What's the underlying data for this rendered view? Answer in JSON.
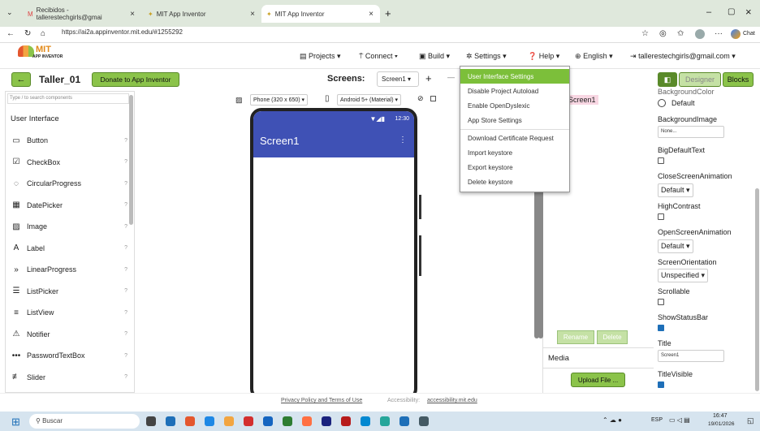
{
  "browser": {
    "tabs": [
      {
        "title": "Recibidos - tallerestechgirls@gmai"
      },
      {
        "title": "MIT App Inventor"
      },
      {
        "title": "MIT App Inventor"
      }
    ],
    "url": "https://ai2a.appinventor.mit.edu/#1255292",
    "chat_label": "Chat"
  },
  "header": {
    "logo_title": "MIT",
    "logo_sub": "APP INVENTOR",
    "menus": [
      "Projects ▾",
      "Connect ▾",
      "Build ▾",
      "Settings ▾",
      "Help ▾",
      "English ▾"
    ],
    "account": "tallerestechgirls@gmail.com ▾"
  },
  "toolbar": {
    "back_label": "←",
    "project_name": "Taller_01",
    "donate_label": "Donate to App Inventor",
    "screens_label": "Screens:",
    "screen_select": "Screen1 ▾",
    "add_label": "+",
    "minus_label": "—",
    "designer_label": "Designer",
    "blocks_label": "Blocks"
  },
  "palette": {
    "search_placeholder": "Type / to search components",
    "category": "User Interface",
    "items": [
      {
        "label": "Button",
        "icon": "▭"
      },
      {
        "label": "CheckBox",
        "icon": "☑"
      },
      {
        "label": "CircularProgress",
        "icon": "◌"
      },
      {
        "label": "DatePicker",
        "icon": "▦"
      },
      {
        "label": "Image",
        "icon": "▨"
      },
      {
        "label": "Label",
        "icon": "A"
      },
      {
        "label": "LinearProgress",
        "icon": "»"
      },
      {
        "label": "ListPicker",
        "icon": "☰"
      },
      {
        "label": "ListView",
        "icon": "≡"
      },
      {
        "label": "Notifier",
        "icon": "⚠"
      },
      {
        "label": "PasswordTextBox",
        "icon": "•••"
      },
      {
        "label": "Slider",
        "icon": "≢"
      }
    ],
    "help": "?"
  },
  "viewer": {
    "device": "Phone (320 x 650) ▾",
    "android": "Android 5+ (Material) ▾",
    "status_time": "12:30",
    "screen_title": "Screen1"
  },
  "components": {
    "screen_item": "Screen1",
    "rename_label": "Rename",
    "delete_label": "Delete",
    "media_label": "Media",
    "upload_label": "Upload File ..."
  },
  "properties": {
    "top_label": "BackgroundColor",
    "default_radio": "Default",
    "bg_image": "BackgroundImage",
    "bg_image_value": "None...",
    "big_default": "BigDefaultText",
    "close_anim": "CloseScreenAnimation",
    "close_anim_value": "Default ▾",
    "high_contrast": "HighContrast",
    "open_anim": "OpenScreenAnimation",
    "open_anim_value": "Default ▾",
    "orientation": "ScreenOrientation",
    "orientation_value": "Unspecified ▾",
    "scrollable": "Scrollable",
    "show_status": "ShowStatusBar",
    "title": "Title",
    "title_value": "Screen1",
    "title_visible": "TitleVisible"
  },
  "settings_menu": {
    "items": [
      "User Interface Settings",
      "Disable Project Autoload",
      "Enable OpenDyslexic",
      "App Store Settings",
      "Download Certificate Request",
      "Import keystore",
      "Export keystore",
      "Delete keystore"
    ]
  },
  "footer": {
    "privacy": "Privacy Policy and Terms of Use",
    "access_prefix": "Accessibility:",
    "access_link": "accessibility.mit.edu"
  },
  "taskbar": {
    "search": "Buscar",
    "lang": "ESP",
    "time": "16:47",
    "date": "19/01/2026"
  },
  "colors": {
    "accent": "#8bc34a",
    "appbar": "#3f51b5",
    "menu_highlight": "#7cbf3a"
  }
}
